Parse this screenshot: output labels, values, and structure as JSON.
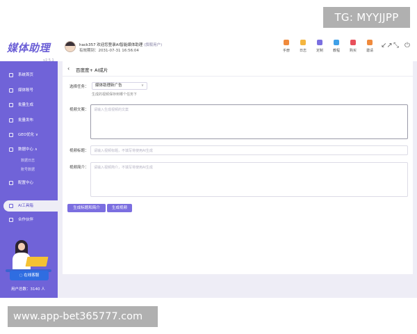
{
  "brand": {
    "logo": "媒体助理",
    "version": "v2.5.1"
  },
  "user": {
    "welcome": "hack357 欢迎您登录AI智能媒体助理",
    "role": "(旗舰用户)",
    "expiry": "有效期到：2031-07-31 16:56:04"
  },
  "toolbar": [
    {
      "label": "手册",
      "icon": "book-icon",
      "color": "#f08a3c"
    },
    {
      "label": "日志",
      "icon": "log-icon",
      "color": "#f4b53f"
    },
    {
      "label": "定制",
      "icon": "custom-icon",
      "color": "#7a6fe0"
    },
    {
      "label": "教程",
      "icon": "tutorial-icon",
      "color": "#3fa0e8"
    },
    {
      "label": "购买",
      "icon": "cart-icon",
      "color": "#e8505b"
    },
    {
      "label": "邀请",
      "icon": "gift-icon",
      "color": "#f08a3c"
    }
  ],
  "window_icons": {
    "shrink": "↙↗",
    "expand": "⤡",
    "power": "⏻"
  },
  "sidebar": {
    "items": [
      {
        "label": "系统首页",
        "icon": "home-icon"
      },
      {
        "label": "媒体账号",
        "icon": "account-icon"
      },
      {
        "label": "批量生成",
        "icon": "edit-icon"
      },
      {
        "label": "批量发布",
        "icon": "send-icon"
      },
      {
        "label": "GEO优化",
        "icon": "geo-icon",
        "suffix": "∨"
      },
      {
        "label": "数据中心",
        "icon": "data-icon",
        "suffix": "∧"
      }
    ],
    "subitems": [
      {
        "label": "数据日志"
      },
      {
        "label": "账号数据"
      }
    ],
    "items_after": [
      {
        "label": "配置中心",
        "icon": "settings-icon"
      }
    ],
    "active": {
      "label": "AI工具箱",
      "icon": "toolbox-icon"
    },
    "items_end": [
      {
        "label": "合作伙伴",
        "icon": "partner-icon"
      }
    ],
    "chat_button": "在线客服",
    "user_count": "用户总数：3140 人"
  },
  "main": {
    "title": "百度度+ AI成片",
    "task_label": "选择任务：",
    "task_value": "媒体助理新广告",
    "task_hint": "生成的视频保存到哪个任务下",
    "copy_label": "视频文案：",
    "copy_placeholder": "请输入生成视频的文案",
    "title_label": "视频标题：",
    "title_placeholder": "请输入视频标题，不填写将使用AI生成",
    "intro_label": "视频简介：",
    "intro_placeholder": "请输入视频简介，不填写将使用AI生成",
    "btn_gen_title": "生成标题和简介",
    "btn_gen_video": "生成视频"
  },
  "watermarks": {
    "tg": "TG: MYYJJPP",
    "url": "www.app-bet365777.com"
  },
  "colors": {
    "accent": "#7063d8",
    "button": "#7b6ee0",
    "chat": "#2f6de1"
  }
}
